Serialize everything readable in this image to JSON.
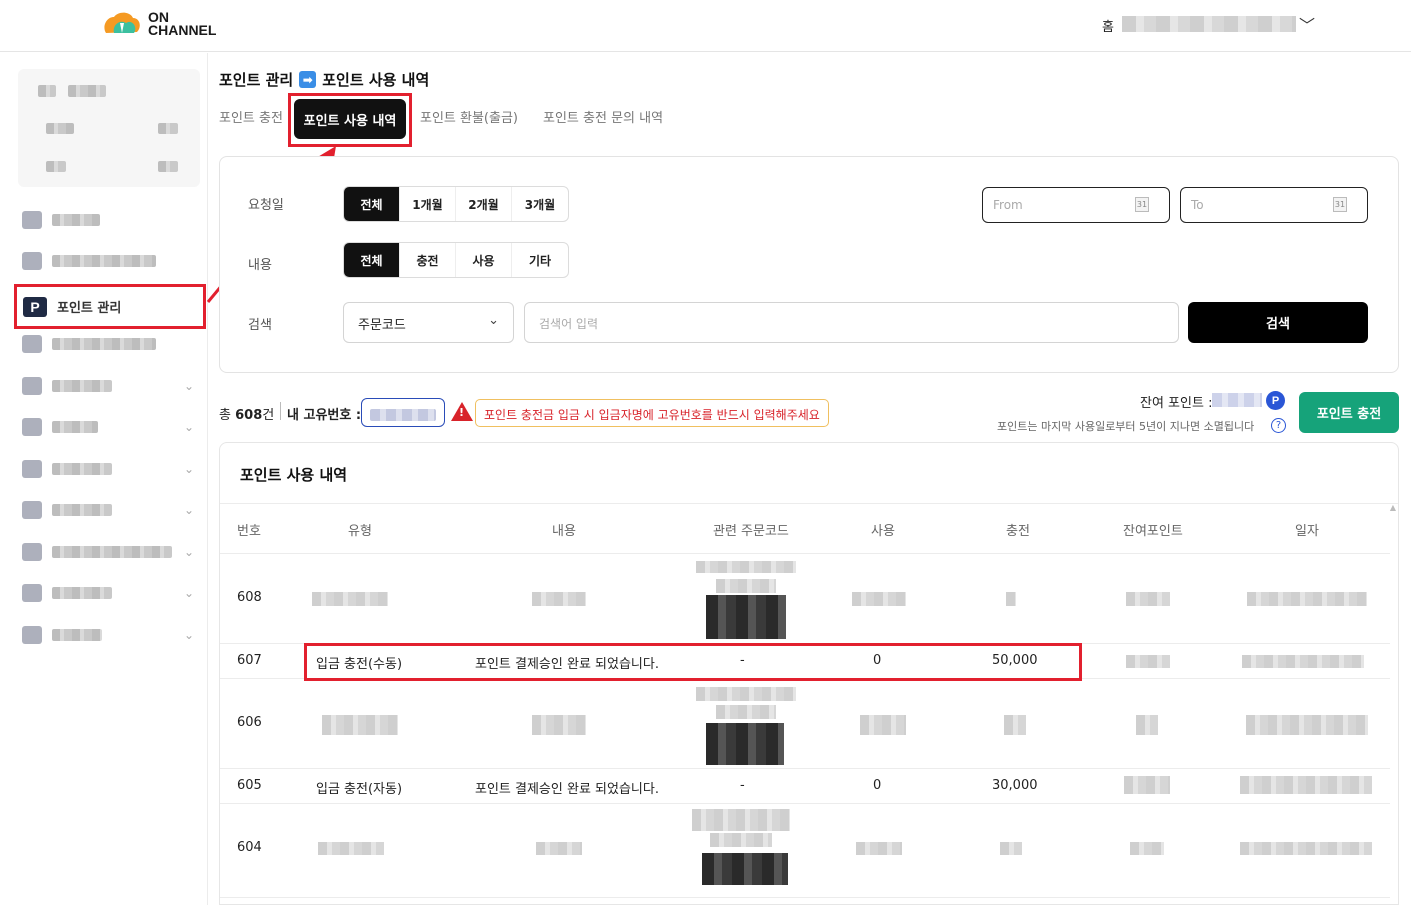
{
  "header": {
    "logo_line1": "ON",
    "logo_line2": "CHANNEL",
    "home": "홈",
    "account_caret": "﹀"
  },
  "sidebar": {
    "point_menu_icon": "P",
    "point_menu_label": "포인트 관리"
  },
  "breadcrumb": {
    "parent": "포인트 관리",
    "arrow": "➡",
    "current": "포인트 사용 내역"
  },
  "tabs": [
    {
      "label": "포인트 충전"
    },
    {
      "label": "포인트 사용 내역"
    },
    {
      "label": "포인트 환불(출금)"
    },
    {
      "label": "포인트 충전 문의 내역"
    }
  ],
  "filter": {
    "date_label": "요청일",
    "period_options": [
      "전체",
      "1개월",
      "2개월",
      "3개월"
    ],
    "content_label": "내용",
    "content_options": [
      "전체",
      "충전",
      "사용",
      "기타"
    ],
    "from_placeholder": "From",
    "to_placeholder": "To",
    "calendar_day": "31",
    "search_label": "검색",
    "search_type": "주문코드",
    "select_caret": "⌄",
    "search_placeholder": "검색어 입력",
    "search_button": "검색"
  },
  "summary": {
    "total_prefix": "총",
    "total_count": "608",
    "total_suffix": "건",
    "my_id_label": "내 고유번호 :",
    "warning_mark": "!",
    "warning": "포인트 충전금 입금 시 입금자명에 고유번호를 반드시 입력해주세요",
    "remain_label": "잔여 포인트 :",
    "point_badge": "P",
    "expire_note": "포인트는 마지막 사용일로부터 5년이 지나면 소멸됩니다",
    "help_mark": "?",
    "charge_button": "포인트 충전"
  },
  "table": {
    "title": "포인트 사용 내역",
    "columns": [
      "번호",
      "유형",
      "내용",
      "관련 주문코드",
      "사용",
      "충전",
      "잔여포인트",
      "일자"
    ],
    "rows": [
      {
        "no": "608",
        "type": "",
        "content": "",
        "order": "",
        "use": "",
        "charge": ""
      },
      {
        "no": "607",
        "type": "입금 충전(수동)",
        "content": "포인트 결제승인 완료 되었습니다.",
        "order": "-",
        "use": "0",
        "charge": "50,000"
      },
      {
        "no": "606",
        "type": "",
        "content": "",
        "order": "",
        "use": "",
        "charge": ""
      },
      {
        "no": "605",
        "type": "입금 충전(자동)",
        "content": "포인트 결제승인 완료 되었습니다.",
        "order": "-",
        "use": "0",
        "charge": "30,000"
      },
      {
        "no": "604",
        "type": "",
        "content": "",
        "order": "",
        "use": "",
        "charge": ""
      }
    ]
  },
  "colors": {
    "highlight": "#e2202e",
    "charge_button": "#16a37a",
    "active_tab": "#111111",
    "point_badge": "#2a56d6"
  }
}
